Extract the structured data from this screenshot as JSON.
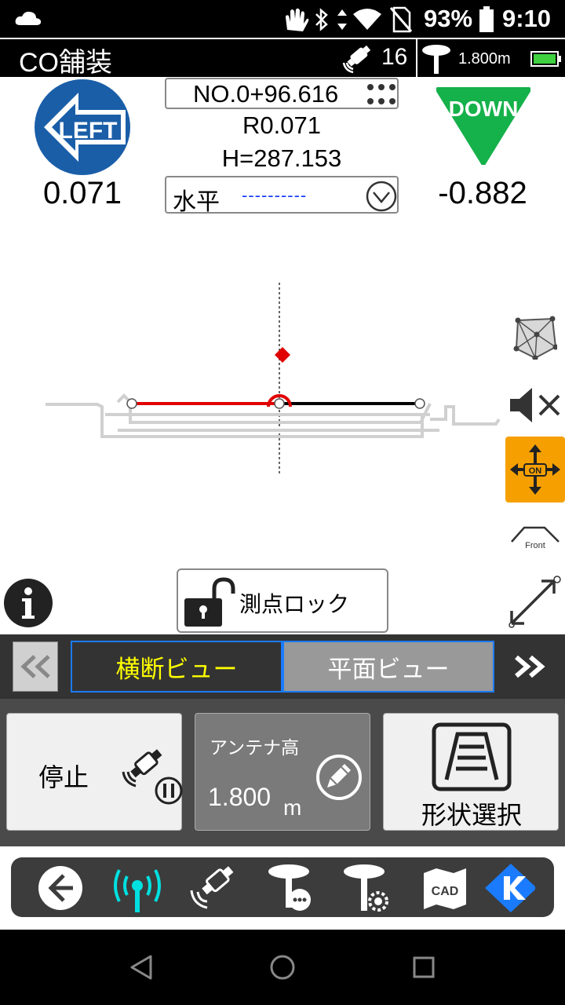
{
  "status": {
    "battery": "93%",
    "time": "9:10"
  },
  "header": {
    "title": "CO舗装",
    "satellites": "16",
    "antenna_height": "1.800m"
  },
  "guidance": {
    "left_label": "LEFT",
    "left_value": "0.071",
    "station": "NO.0+96.616",
    "offset": "R0.071",
    "height": "H=287.153",
    "mode": "水平",
    "mode_value": "----------",
    "down_label": "DOWN",
    "down_value": "-0.882"
  },
  "side_tools": {
    "front_label": "Front",
    "on_label": "ON"
  },
  "lock_button": "測点ロック",
  "view_tabs": [
    {
      "label": "横断ビュー"
    },
    {
      "label": "平面ビュー"
    }
  ],
  "actions": {
    "stop_label": "停止",
    "antenna_label": "アンテナ高",
    "antenna_value": "1.800",
    "antenna_unit": "m",
    "shape_label": "形状選択"
  },
  "nav": {
    "cad_label": "CAD"
  },
  "colors": {
    "accent_blue": "#1a5ea8",
    "down_green": "#15b14a",
    "active_tab_text": "#ffff00",
    "orange": "#f5a000",
    "gnss_cyan": "#00e0e0"
  }
}
